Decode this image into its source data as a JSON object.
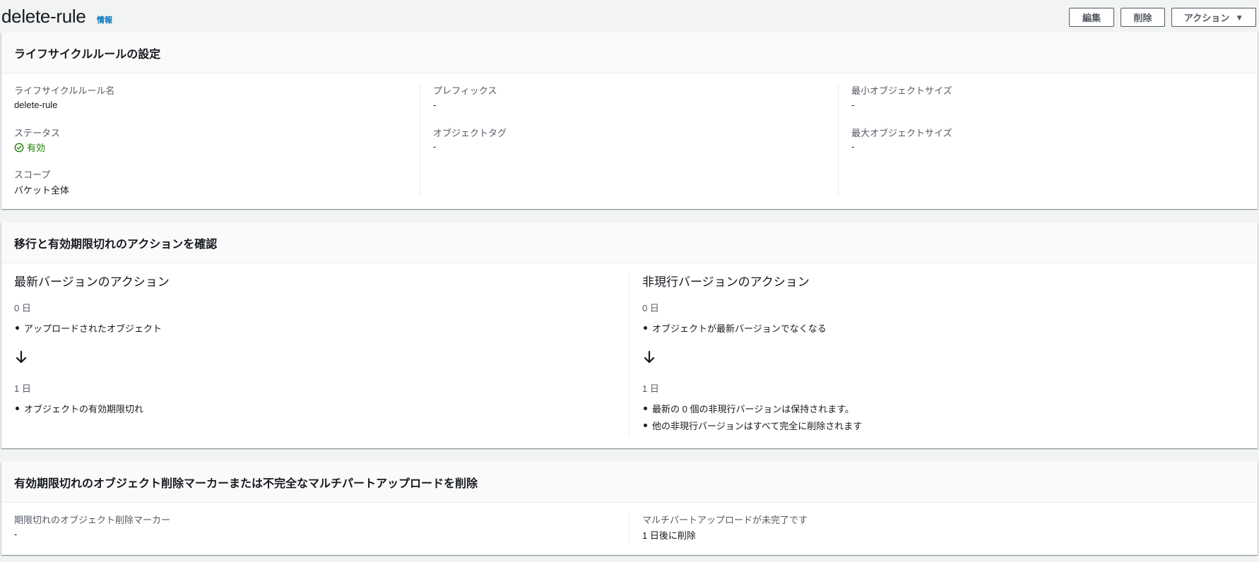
{
  "header": {
    "title": "delete-rule",
    "info": "情報",
    "edit_label": "編集",
    "delete_label": "削除",
    "actions_label": "アクション"
  },
  "config": {
    "title": "ライフサイクルルールの設定",
    "rule_name_label": "ライフサイクルルール名",
    "rule_name": "delete-rule",
    "status_label": "ステータス",
    "status": "有効",
    "scope_label": "スコープ",
    "scope": "バケット全体",
    "prefix_label": "プレフィックス",
    "prefix": "-",
    "tags_label": "オブジェクトタグ",
    "tags": "-",
    "min_size_label": "最小オブジェクトサイズ",
    "min_size": "-",
    "max_size_label": "最大オブジェクトサイズ",
    "max_size": "-"
  },
  "actions_review": {
    "title": "移行と有効期限切れのアクションを確認",
    "current": {
      "heading": "最新バージョンのアクション",
      "day0": "0 日",
      "day0_items": [
        "アップロードされたオブジェクト"
      ],
      "day1": "1 日",
      "day1_items": [
        "オブジェクトの有効期限切れ"
      ]
    },
    "noncurrent": {
      "heading": "非現行バージョンのアクション",
      "day0": "0 日",
      "day0_items": [
        "オブジェクトが最新バージョンでなくなる"
      ],
      "day1": "1 日",
      "day1_items": [
        "最新の 0 個の非現行バージョンは保持されます。",
        "他の非現行バージョンはすべて完全に削除されます"
      ]
    }
  },
  "cleanup": {
    "title": "有効期限切れのオブジェクト削除マーカーまたは不完全なマルチパートアップロードを削除",
    "markers_label": "期限切れのオブジェクト削除マーカー",
    "markers": "-",
    "multipart_label": "マルチパートアップロードが未完了です",
    "multipart": "1 日後に削除"
  },
  "colors": {
    "link": "#0073bb",
    "success": "#1d8102",
    "text": "#16191f",
    "label": "#545b64"
  }
}
